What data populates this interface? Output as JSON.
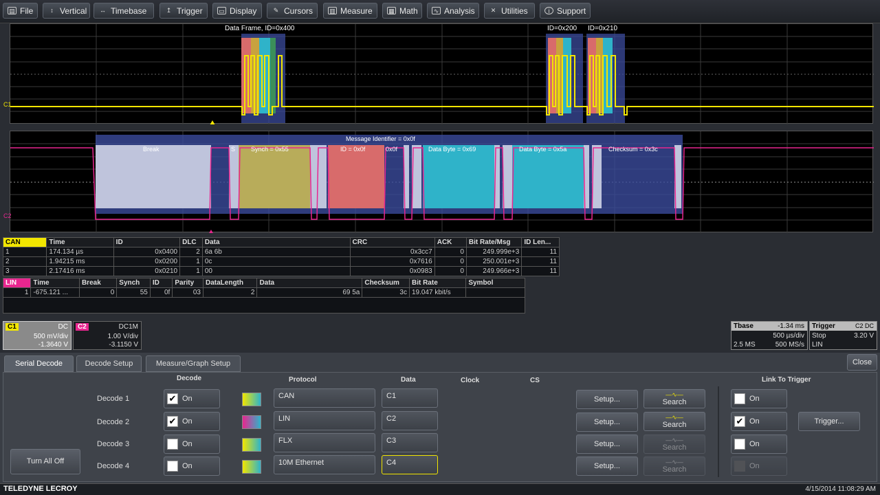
{
  "menu": [
    {
      "label": "File",
      "icon": "file-icon"
    },
    {
      "label": "Vertical",
      "icon": "vertical-icon"
    },
    {
      "label": "Timebase",
      "icon": "timebase-icon"
    },
    {
      "label": "Trigger",
      "icon": "trigger-icon"
    },
    {
      "label": "Display",
      "icon": "display-icon"
    },
    {
      "label": "Cursors",
      "icon": "cursors-icon"
    },
    {
      "label": "Measure",
      "icon": "measure-icon"
    },
    {
      "label": "Math",
      "icon": "math-icon"
    },
    {
      "label": "Analysis",
      "icon": "analysis-icon"
    },
    {
      "label": "Utilities",
      "icon": "utilities-icon"
    },
    {
      "label": "Support",
      "icon": "support-icon"
    }
  ],
  "grid1": {
    "frame_label": "Data Frame, ID=0x400",
    "id_label_2": "ID=0x200",
    "id_label_3": "ID=0x210",
    "trace_label": "C1"
  },
  "grid2": {
    "message_label": "Message Identifier = 0x0f",
    "fields": {
      "break": "Break",
      "s1": "S",
      "synch": "Synch = 0x55",
      "id": "ID = 0x0f",
      "data1": "Data Byte = 0x69",
      "data2": "Data Byte = 0x5a",
      "checksum": "Checksum = 0x3c",
      "idhex": "0x0f"
    },
    "trace_label": "C2"
  },
  "can_table": {
    "headers": [
      "CAN",
      "Time",
      "ID",
      "DLC",
      "Data",
      "CRC",
      "ACK",
      "Bit Rate/Msg",
      "ID Len..."
    ],
    "rows": [
      [
        "1",
        "174.134 µs",
        "0x0400",
        "2",
        "6a 6b",
        "0x3cc7",
        "0",
        "249.999e+3",
        "11"
      ],
      [
        "2",
        "1.94215 ms",
        "0x0200",
        "1",
        "0c",
        "0x7616",
        "0",
        "250.001e+3",
        "11"
      ],
      [
        "3",
        "2.17416 ms",
        "0x0210",
        "1",
        "00",
        "0x0983",
        "0",
        "249.966e+3",
        "11"
      ]
    ]
  },
  "lin_table": {
    "headers": [
      "LIN",
      "Time",
      "Break",
      "Synch",
      "ID",
      "Parity",
      "DataLength",
      "Data",
      "Checksum",
      "Bit Rate",
      "Symbol"
    ],
    "rows": [
      [
        "1",
        "-675.121 ...",
        "0",
        "55",
        "0f",
        "03",
        "2",
        "69 5a",
        "3c",
        "19.047 kbit/s",
        ""
      ]
    ]
  },
  "channels": {
    "c1": {
      "name": "C1",
      "coupling": "DC",
      "vdiv": "500 mV/div",
      "offset": "-1.3640 V"
    },
    "c2": {
      "name": "C2",
      "coupling": "DC1M",
      "vdiv": "1.00 V/div",
      "offset": "-3.1150 V"
    }
  },
  "timebase": {
    "label": "Tbase",
    "delay": "-1.34 ms",
    "tdiv": "500 µs/div",
    "samples": "2.5 MS",
    "rate": "500 MS/s"
  },
  "trigger": {
    "label": "Trigger",
    "slots": "C2 DC",
    "mode": "Stop",
    "level": "3.20 V",
    "type": "LIN"
  },
  "tabs": [
    "Serial Decode",
    "Decode Setup",
    "Measure/Graph Setup"
  ],
  "close_label": "Close",
  "columns": {
    "decode": "Decode",
    "protocol": "Protocol",
    "data": "Data",
    "clock": "Clock",
    "cs": "CS",
    "link": "Link To Trigger"
  },
  "decodes": [
    {
      "label": "Decode 1",
      "on": "On",
      "checked": true,
      "protocol": "CAN",
      "data": "C1",
      "setup": "Setup...",
      "search": "Search",
      "link_on": "On",
      "link_checked": false
    },
    {
      "label": "Decode 2",
      "on": "On",
      "checked": true,
      "protocol": "LIN",
      "data": "C2",
      "setup": "Setup...",
      "search": "Search",
      "link_on": "On",
      "link_checked": true
    },
    {
      "label": "Decode 3",
      "on": "On",
      "checked": false,
      "protocol": "FLX",
      "data": "C3",
      "setup": "Setup...",
      "search": "Search",
      "link_on": "On",
      "link_checked": false
    },
    {
      "label": "Decode 4",
      "on": "On",
      "checked": false,
      "protocol": "10M Ethernet",
      "data": "C4",
      "setup": "Setup...",
      "search": "Search",
      "link_on": "On",
      "link_checked": false
    }
  ],
  "trigger_button": "Trigger...",
  "turn_all_off": "Turn All Off",
  "footer": {
    "brand": "TELEDYNE LECROY",
    "datetime": "4/15/2014 11:08:29 AM"
  },
  "colors": {
    "c1": "#f2e600",
    "c2": "#e8268f",
    "accent": "#f2e600"
  }
}
